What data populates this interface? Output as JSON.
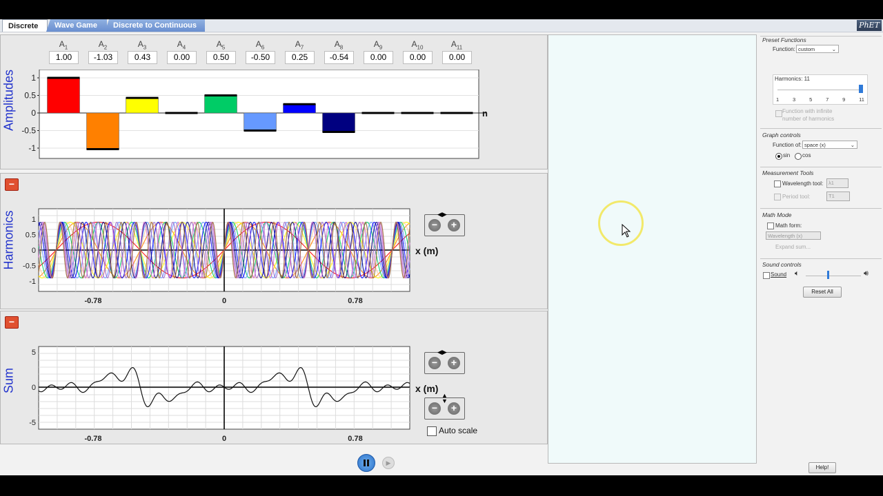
{
  "tabs": [
    {
      "label": "Discrete",
      "active": true
    },
    {
      "label": "Wave Game",
      "active": false
    },
    {
      "label": "Discrete to Continuous",
      "active": false
    }
  ],
  "logo_text": "PhET",
  "amplitudes": {
    "axis_label": "Amplitudes",
    "n_label": "n",
    "coefficients": [
      {
        "name": "A",
        "sub": "1",
        "value": "1.00",
        "num": 1.0,
        "color": "#ff0000"
      },
      {
        "name": "A",
        "sub": "2",
        "value": "-1.03",
        "num": -1.03,
        "color": "#ff8000"
      },
      {
        "name": "A",
        "sub": "3",
        "value": "0.43",
        "num": 0.43,
        "color": "#ffff00"
      },
      {
        "name": "A",
        "sub": "4",
        "value": "0.00",
        "num": 0.0,
        "color": "#ffcc99"
      },
      {
        "name": "A",
        "sub": "5",
        "value": "0.50",
        "num": 0.5,
        "color": "#00cc66"
      },
      {
        "name": "A",
        "sub": "6",
        "value": "-0.50",
        "num": -0.5,
        "color": "#6699ff"
      },
      {
        "name": "A",
        "sub": "7",
        "value": "0.25",
        "num": 0.25,
        "color": "#0000ff"
      },
      {
        "name": "A",
        "sub": "8",
        "value": "-0.54",
        "num": -0.54,
        "color": "#000080"
      },
      {
        "name": "A",
        "sub": "9",
        "value": "0.00",
        "num": 0.0,
        "color": "#9966cc"
      },
      {
        "name": "A",
        "sub": "10",
        "value": "0.00",
        "num": 0.0,
        "color": "#cc66cc"
      },
      {
        "name": "A",
        "sub": "11",
        "value": "0.00",
        "num": 0.0,
        "color": "#996633"
      }
    ],
    "y_ticks": [
      "1",
      "0.5",
      "0",
      "-0.5",
      "-1"
    ]
  },
  "harmonics": {
    "axis_label": "Harmonics",
    "y_ticks": [
      "1",
      "0.5",
      "0",
      "-0.5",
      "-1"
    ],
    "x_ticks": [
      "-0.78",
      "0",
      "0.78"
    ],
    "x_unit": "x (m)"
  },
  "sum": {
    "axis_label": "Sum",
    "y_ticks": [
      "5",
      "0",
      "-5"
    ],
    "x_ticks": [
      "-0.78",
      "0",
      "0.78"
    ],
    "x_unit": "x (m)",
    "auto_scale_label": "Auto scale"
  },
  "controls": {
    "preset_title": "Preset Functions",
    "function_label": "Function:",
    "function_value": "custom",
    "harmonics_label": "Harmonics: 11",
    "harmonics_ticks": [
      "1",
      "3",
      "5",
      "7",
      "9",
      "11"
    ],
    "infinite_label_1": "Function with infinite",
    "infinite_label_2": "number of harmonics",
    "graph_title": "Graph controls",
    "function_of_label": "Function of:",
    "function_of_value": "space (x)",
    "sin_label": "sin",
    "cos_label": "cos",
    "measure_title": "Measurement Tools",
    "wavelength_label": "Wavelength tool:",
    "wavelength_sym": "λ1",
    "period_label": "Period tool:",
    "period_sym": "T1",
    "math_title": "Math Mode",
    "math_form_label": "Math form:",
    "math_form_value": "Wavelength (x)",
    "expand_label": "Expand sum...",
    "sound_title": "Sound controls",
    "sound_label": "Sound",
    "reset_label": "Reset All"
  },
  "help_label": "Help!"
}
